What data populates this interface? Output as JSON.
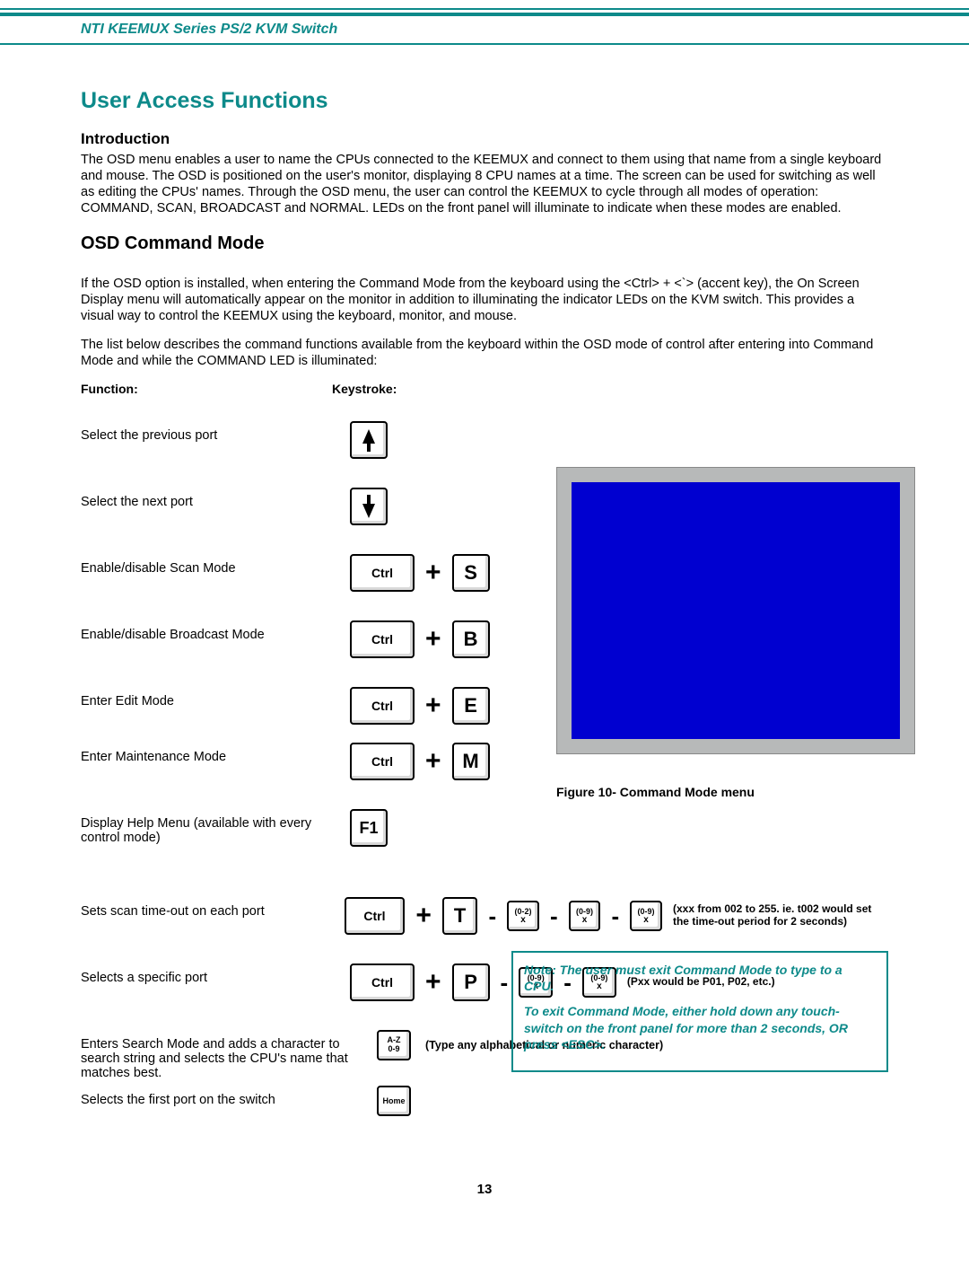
{
  "header": "NTI KEEMUX Series   PS/2 KVM Switch",
  "title": "User Access Functions",
  "intro_head": "Introduction",
  "intro_para": "The OSD menu enables a user to name the CPUs connected to the KEEMUX and connect to them using that name from a single keyboard and mouse.  The OSD is positioned on the user's monitor, displaying 8 CPU names at a time.  The screen can be used for switching as well as editing the CPUs' names. Through the OSD menu,  the user can control the KEEMUX to cycle through all modes of operation:  COMMAND,  SCAN, BROADCAST and NORMAL.    LEDs on the front panel will illuminate to indicate when these modes are enabled.",
  "cmd_head": "OSD Command Mode",
  "cmd_p1": "If the OSD option is installed, when entering the Command Mode from the keyboard using the  <Ctrl> + <`> (accent key), the On Screen Display menu will automatically appear on the monitor in addition to illuminating the indicator LEDs on the KVM switch.    This provides a visual way to control the KEEMUX using the keyboard, monitor, and mouse.",
  "cmd_p2": "The list below describes the command functions available from the keyboard within the OSD mode of control after entering into Command Mode and while the COMMAND LED is illuminated:",
  "col_function": "Function:",
  "col_keystroke": "Keystroke:",
  "rows": {
    "prev": "Select the previous port",
    "next": "Select the next port",
    "scan": "Enable/disable Scan Mode",
    "broadcast": "Enable/disable Broadcast Mode",
    "edit": "Enter Edit Mode",
    "maint": "Enter Maintenance Mode",
    "help": "Display Help Menu (available with every control mode)",
    "timeout": "Sets scan time-out on each port",
    "selectport": "Selects a specific port",
    "search": "Enters Search Mode and adds a character to search string and selects the CPU's name that matches best.",
    "first": "Selects the first port on the switch"
  },
  "keys": {
    "ctrl": "Ctrl",
    "S": "S",
    "B": "B",
    "E": "E",
    "M": "M",
    "F1": "F1",
    "T": "T",
    "P": "P",
    "home": "Home",
    "az": "A-Z\n0-9",
    "d02": "(0-2)",
    "d09": "(0-9)",
    "x": "x"
  },
  "fig_caption": "Figure 10- Command Mode menu",
  "timeout_note": "(xxx from 002 to 255.   ie.  t002 would set the time-out period for 2 seconds)",
  "port_note": "(Pxx would be P01, P02, etc.)",
  "search_note": "(Type any alphabetical or numeric character)",
  "note1": "Note:  The user must exit Command Mode to type to a CPU.",
  "note2": "To exit Command Mode, either hold down any touch-switch on the front panel for more than 2 seconds, OR  press <ESC>.",
  "page_num": "13"
}
